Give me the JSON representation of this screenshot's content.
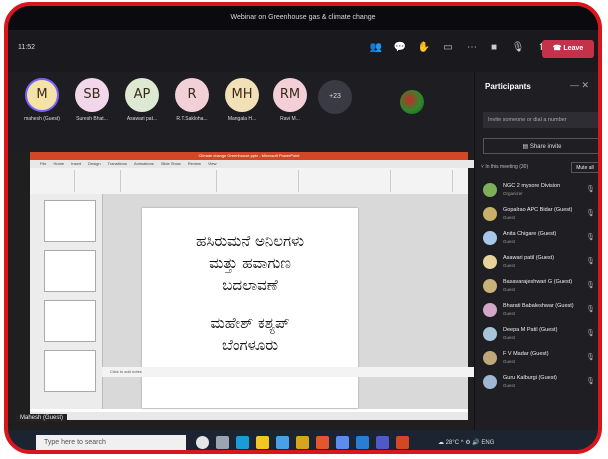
{
  "window": {
    "title": "Webinar on Greenhouse gas & climate change"
  },
  "toolbar": {
    "time": "11:52",
    "leave_label": "Leave"
  },
  "avatars": [
    {
      "initials": "M",
      "name": "mahesh (Guest)",
      "color": "#f3e3a7"
    },
    {
      "initials": "SB",
      "name": "Suresh Bhat...",
      "color": "#f2d6ea"
    },
    {
      "initials": "AP",
      "name": "Asawari pat...",
      "color": "#dde9d2"
    },
    {
      "initials": "R",
      "name": "R.T.Sakloha...",
      "color": "#f2d0d8"
    },
    {
      "initials": "MH",
      "name": "Mangala H...",
      "color": "#f2e1b6"
    },
    {
      "initials": "RM",
      "name": "Ravi M...",
      "color": "#f3cfd8"
    }
  ],
  "more_count": "+23",
  "presenter_name": "Mahesh (Guest)",
  "ppt": {
    "title_text": "Climate change Greenhouse.pptx - Microsoft PowerPoint",
    "tabs": [
      "File",
      "Home",
      "Insert",
      "Design",
      "Transitions",
      "Animations",
      "Slide Show",
      "Review",
      "View"
    ],
    "notes": "Click to add notes",
    "slide_lines": [
      "ಹಸಿರುಮನೆ ಅನಿಲಗಳು",
      "ಮತ್ತು ಹವಾಗುಣ",
      "ಬದಲಾವಣೆ",
      "",
      "ಮಹೇಶ್ ಕಶ್ಯಪ್",
      "ಬೆಂಗಳೂರು"
    ]
  },
  "taskbar": {
    "search_placeholder": "Type here to search",
    "temp": "28°C",
    "lang": "ENG"
  },
  "participants": {
    "title": "Participants",
    "search_placeholder": "Invite someone or dial a number",
    "share_invite": "Share invite",
    "meeting_header": "In this meeting (30)",
    "mute_all": "Mute all",
    "list": [
      {
        "name": "NGC 2 mysore Division",
        "role": "Organizer",
        "color": "#7fae5a"
      },
      {
        "name": "Gopalrao APC Bidar (Guest)",
        "role": "Guest",
        "color": "#c8b06a"
      },
      {
        "name": "Anita Chigare (Guest)",
        "role": "Guest",
        "color": "#a7c7e8"
      },
      {
        "name": "Asawari patil (Guest)",
        "role": "Guest",
        "color": "#e6d49a"
      },
      {
        "name": "Basavarajeshwari G (Guest)",
        "role": "Guest",
        "color": "#c9b27a"
      },
      {
        "name": "Bharati Babaleshwar (Guest)",
        "role": "Guest",
        "color": "#d3a5c6"
      },
      {
        "name": "Deepa M Patil (Guest)",
        "role": "Guest",
        "color": "#a9c4d9"
      },
      {
        "name": "F V Madar (Guest)",
        "role": "Guest",
        "color": "#bfa77a"
      },
      {
        "name": "Guru Kalburgi (Guest)",
        "role": "Guest",
        "color": "#9fb7d2"
      }
    ]
  }
}
